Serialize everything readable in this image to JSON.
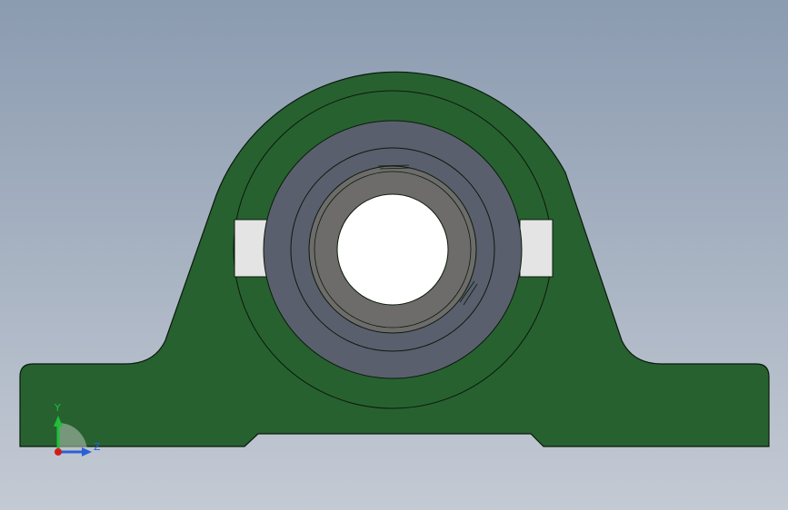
{
  "model": {
    "name": "pillow-block-bearing",
    "colors": {
      "background_top": "#8b9bb0",
      "background_bottom": "#c4cad4",
      "housing": "#276130",
      "outline": "#0b1a0b",
      "insert_outer": "#5a5f6e",
      "inner_race": "#6d6c6a",
      "bore": "#ffffff",
      "slot_fill": "#e4e4e4"
    }
  },
  "triad": {
    "y_label": "Y",
    "z_label": "Z",
    "y_color": "#1fbf3a",
    "z_color": "#2a5fd8",
    "x_color": "#d11a1a"
  }
}
